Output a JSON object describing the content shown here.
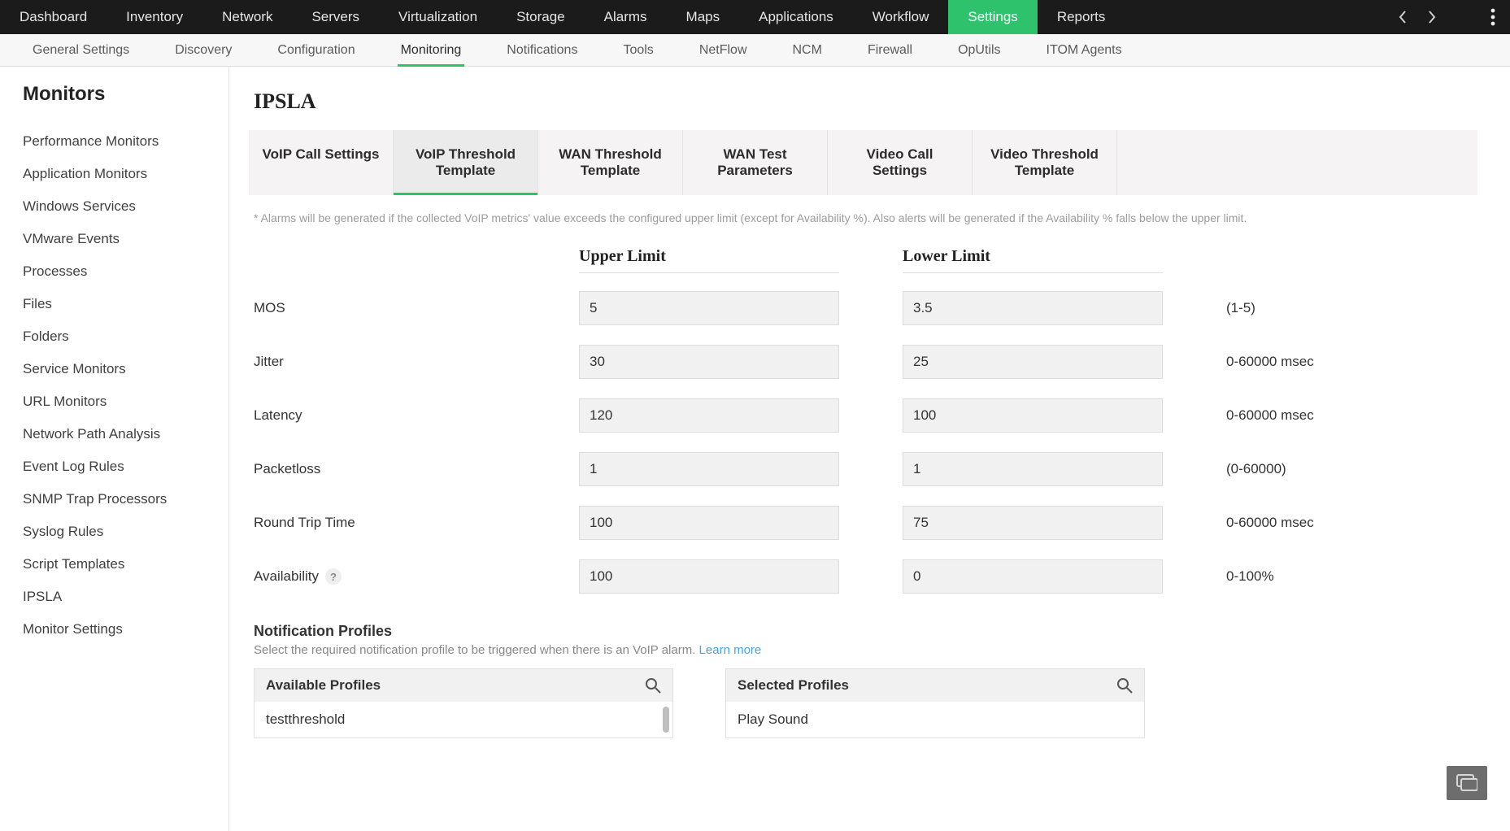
{
  "topnav": {
    "items": [
      "Dashboard",
      "Inventory",
      "Network",
      "Servers",
      "Virtualization",
      "Storage",
      "Alarms",
      "Maps",
      "Applications",
      "Workflow",
      "Settings",
      "Reports"
    ],
    "active": "Settings"
  },
  "subnav": {
    "items": [
      "General Settings",
      "Discovery",
      "Configuration",
      "Monitoring",
      "Notifications",
      "Tools",
      "NetFlow",
      "NCM",
      "Firewall",
      "OpUtils",
      "ITOM Agents"
    ],
    "active": "Monitoring"
  },
  "sidebar": {
    "title": "Monitors",
    "items": [
      "Performance Monitors",
      "Application Monitors",
      "Windows Services",
      "VMware Events",
      "Processes",
      "Files",
      "Folders",
      "Service Monitors",
      "URL Monitors",
      "Network Path Analysis",
      "Event Log Rules",
      "SNMP Trap Processors",
      "Syslog Rules",
      "Script Templates",
      "IPSLA",
      "Monitor Settings"
    ],
    "active": "IPSLA"
  },
  "page": {
    "title": "IPSLA"
  },
  "tabs": {
    "items": [
      "VoIP Call Settings",
      "VoIP Threshold Template",
      "WAN Threshold Template",
      "WAN Test Parameters",
      "Video Call Settings",
      "Video Threshold Template"
    ],
    "active": "VoIP Threshold Template"
  },
  "note_text": "Alarms will be generated if the collected VoIP metrics' value exceeds the configured upper limit (except for Availability %). Also alerts will be generated if the Availability % falls below the upper limit.",
  "threshold_headers": {
    "upper": "Upper Limit",
    "lower": "Lower Limit"
  },
  "thresholds": [
    {
      "label": "MOS",
      "upper": "5",
      "lower": "3.5",
      "range": "(1-5)",
      "help": false
    },
    {
      "label": "Jitter",
      "upper": "30",
      "lower": "25",
      "range": "0-60000 msec",
      "help": false
    },
    {
      "label": "Latency",
      "upper": "120",
      "lower": "100",
      "range": "0-60000 msec",
      "help": false
    },
    {
      "label": "Packetloss",
      "upper": "1",
      "lower": "1",
      "range": "(0-60000)",
      "help": false
    },
    {
      "label": "Round Trip Time",
      "upper": "100",
      "lower": "75",
      "range": "0-60000 msec",
      "help": false
    },
    {
      "label": "Availability",
      "upper": "100",
      "lower": "0",
      "range": "0-100%",
      "help": true
    }
  ],
  "notification": {
    "title": "Notification Profiles",
    "desc": "Select the required notification profile to be triggered when there is an VoIP alarm. ",
    "learn_more": "Learn more",
    "available_header": "Available Profiles",
    "selected_header": "Selected Profiles",
    "available_items": [
      "testthreshold"
    ],
    "selected_items": [
      "Play Sound"
    ]
  }
}
